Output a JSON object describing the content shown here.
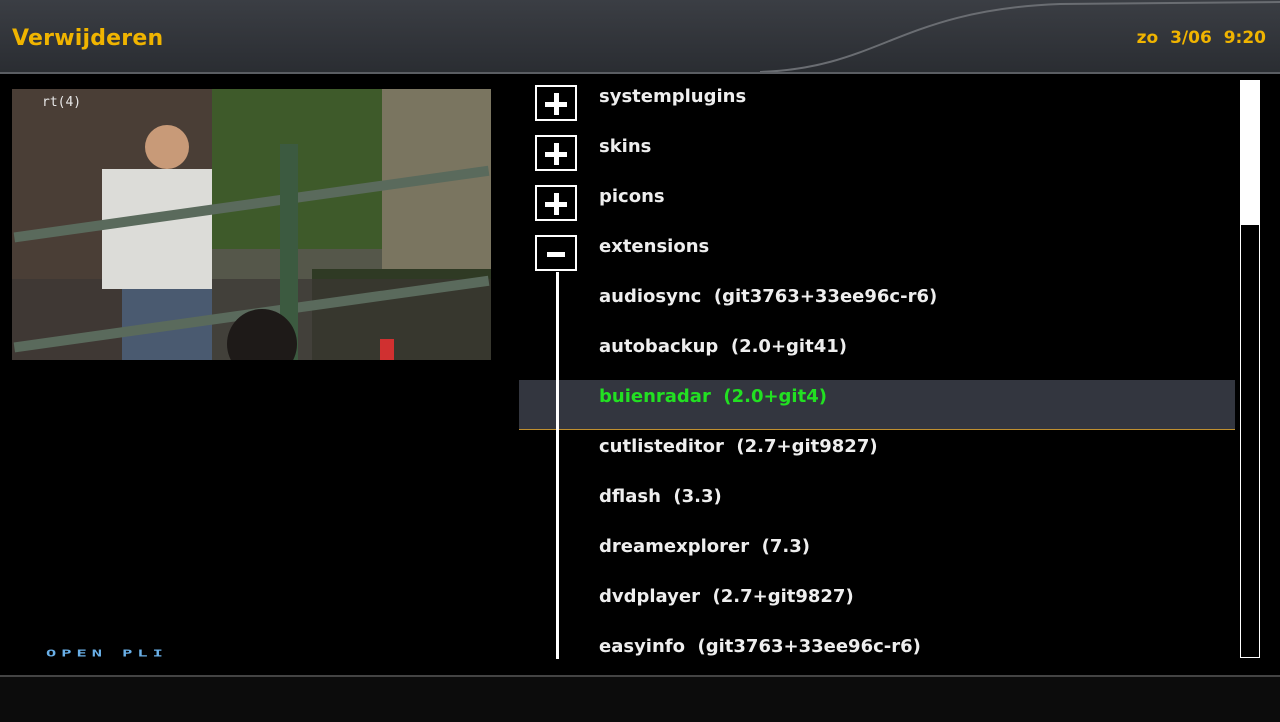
{
  "header": {
    "title": "Verwijderen",
    "clock": "zo 3/06 9:20"
  },
  "preview": {
    "channel_osd": "rt(4)"
  },
  "logo": "OPEN PLI",
  "plugin_list": {
    "selected_index": 6,
    "categories": [
      {
        "label": "systemplugins",
        "state": "collapsed"
      },
      {
        "label": "skins",
        "state": "collapsed"
      },
      {
        "label": "picons",
        "state": "collapsed"
      },
      {
        "label": "extensions",
        "state": "expanded"
      }
    ],
    "items": [
      {
        "label": "audiosync  (git3763+33ee96c-r6)"
      },
      {
        "label": "autobackup  (2.0+git41)"
      },
      {
        "label": "buienradar  (2.0+git4)"
      },
      {
        "label": "cutlisteditor  (2.7+git9827)"
      },
      {
        "label": "dflash  (3.3)"
      },
      {
        "label": "dreamexplorer  (7.3)"
      },
      {
        "label": "dvdplayer  (2.7+git9827)"
      },
      {
        "label": "easyinfo  (git3763+33ee96c-r6)"
      }
    ]
  },
  "colors": {
    "accent": "#f0b400",
    "selected_text": "#22e022",
    "selection_bg": "#33363f"
  }
}
